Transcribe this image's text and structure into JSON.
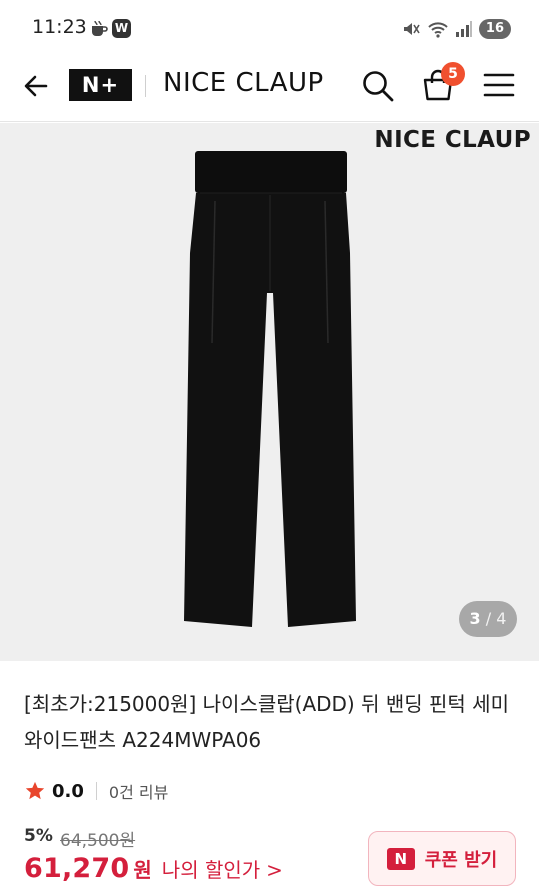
{
  "status_bar": {
    "time": "11:23",
    "app_icon_label": "W",
    "battery": "16",
    "icons": [
      "coffee-icon",
      "w-app-icon",
      "mute-icon",
      "wifi-icon",
      "signal-icon",
      "battery-icon"
    ]
  },
  "header": {
    "logo": "N+",
    "brand": "NICE CLAUP",
    "cart_count": "5",
    "icons": [
      "back-arrow-icon",
      "search-icon",
      "shopping-bag-icon",
      "hamburger-menu-icon"
    ]
  },
  "gallery": {
    "brand_watermark": "NICE CLAUP",
    "current": "3",
    "separator": "/",
    "total": "4",
    "image_subject": "black-wide-pants"
  },
  "product": {
    "title": "[최초가:215000원] 나이스클랍(ADD) 뒤 밴딩 핀턱 세미 와이드팬츠 A224MWPA06",
    "rating": "0.0",
    "review_count": "0건 리뷰",
    "discount": "5%",
    "original_price": "64,500원",
    "price": "61,270",
    "price_unit": "원",
    "my_discount": "나의 할인가",
    "chevron": ">"
  },
  "coupon": {
    "badge": "N",
    "label": "쿠폰 받기"
  },
  "colors": {
    "accent_red": "#d41f3c",
    "badge_orange": "#f0502f",
    "gallery_bg": "#efefef"
  }
}
